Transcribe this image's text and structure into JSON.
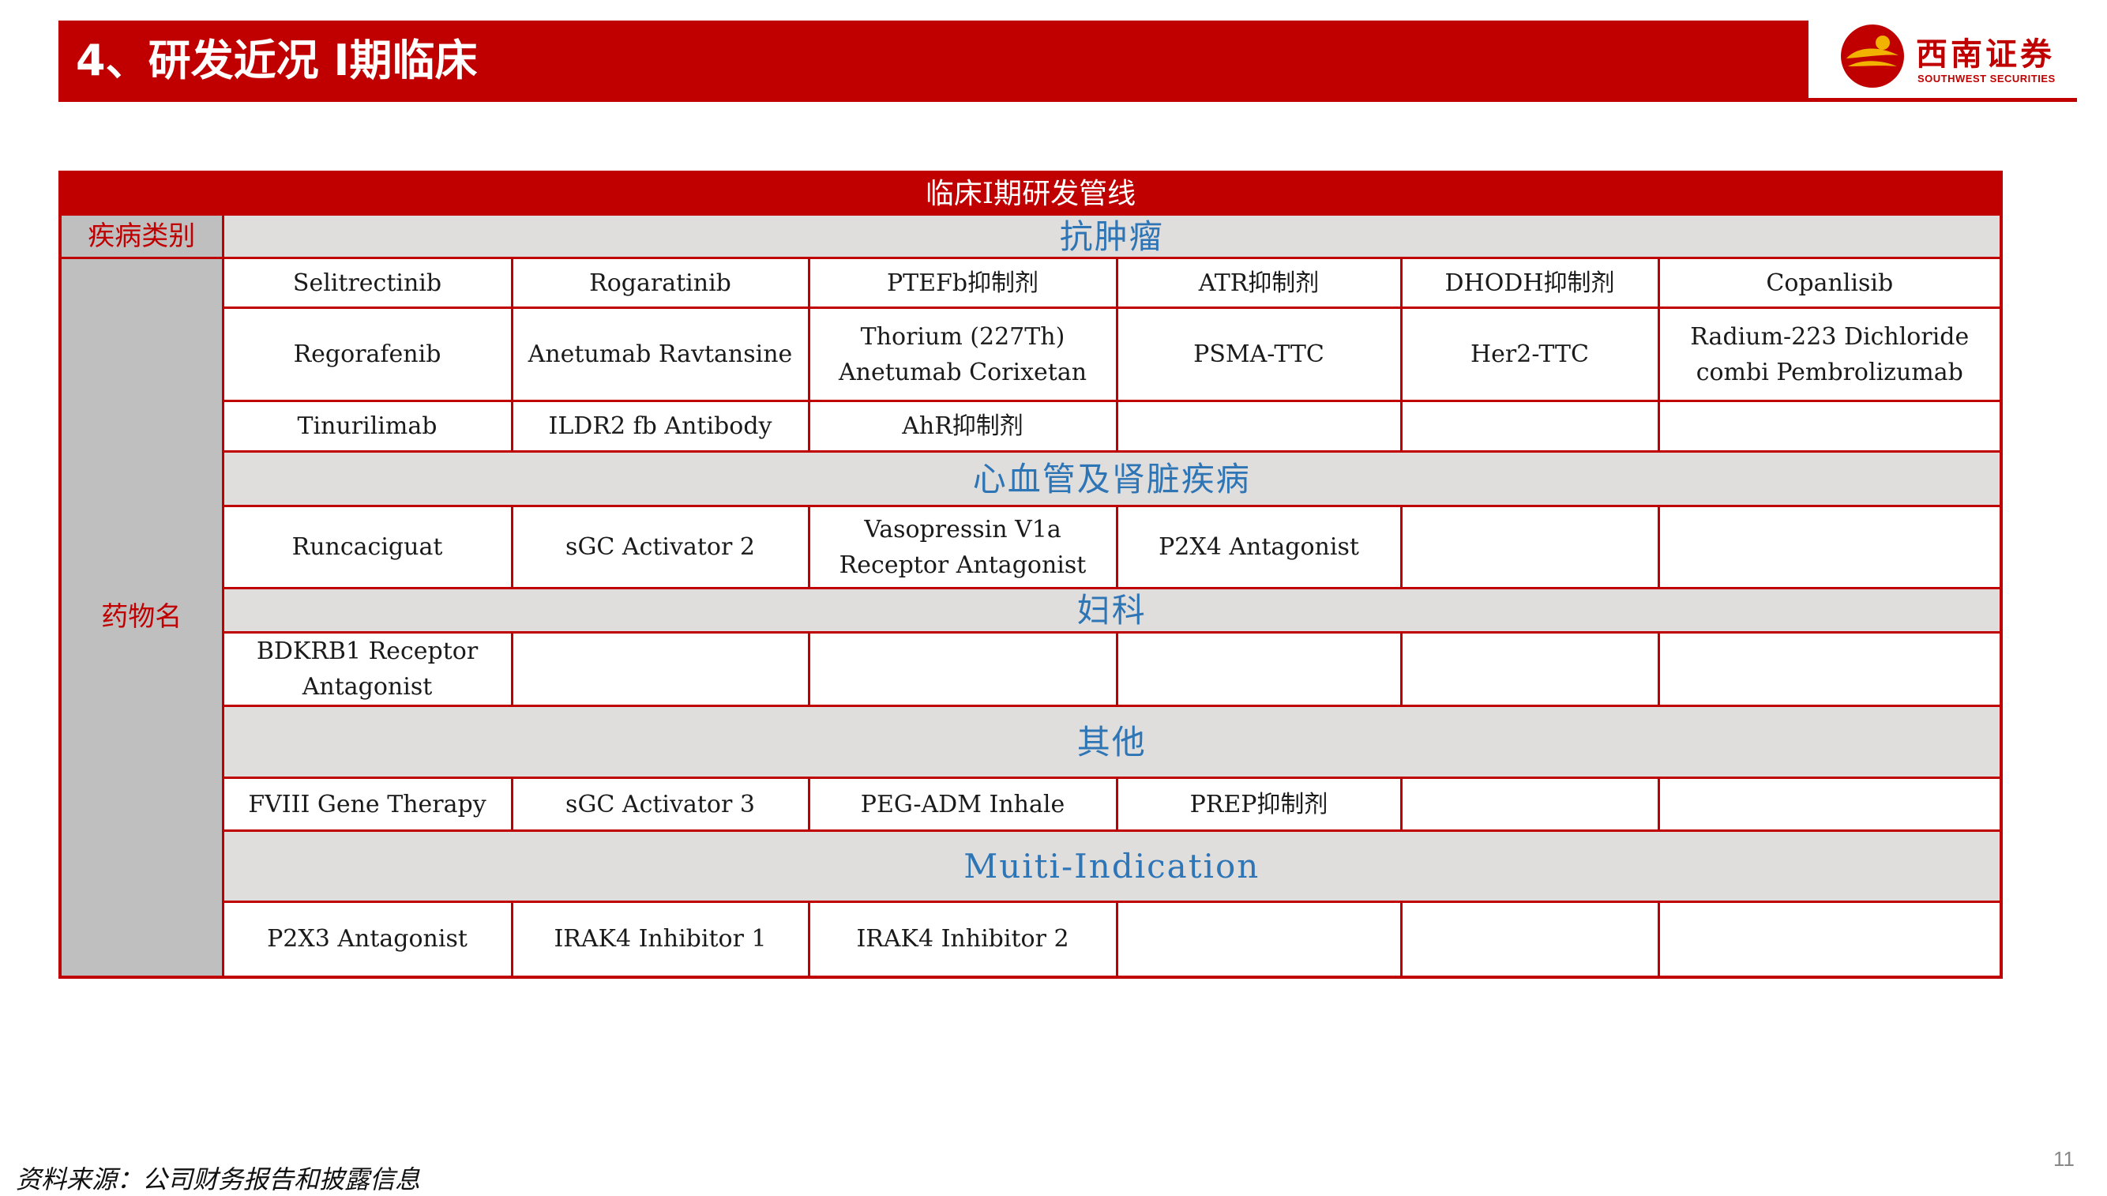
{
  "header": {
    "title": "4、研发近况 I期临床",
    "logo_cn": "西南证券",
    "logo_en": "SOUTHWEST SECURITIES"
  },
  "table": {
    "title": "临床I期研发管线",
    "disease_label": "疾病类别",
    "drug_label": "药物名",
    "sections": [
      {
        "category": "抗肿瘤",
        "rows": [
          [
            "Selitrectinib",
            "Rogaratinib",
            "PTEFb抑制剂",
            "ATR抑制剂",
            "DHODH抑制剂",
            "Copanlisib"
          ],
          [
            "Regorafenib",
            "Anetumab Ravtansine",
            "Thorium (227Th) Anetumab Corixetan",
            "PSMA-TTC",
            "Her2-TTC",
            "Radium-223 Dichloride combi Pembrolizumab"
          ],
          [
            "Tinurilimab",
            "ILDR2 fb Antibody",
            "AhR抑制剂",
            "",
            "",
            ""
          ]
        ]
      },
      {
        "category": "心血管及肾脏疾病",
        "rows": [
          [
            "Runcaciguat",
            "sGC Activator 2",
            "Vasopressin V1a Receptor Antagonist",
            "P2X4 Antagonist",
            "",
            ""
          ]
        ]
      },
      {
        "category": "妇科",
        "rows": [
          [
            "BDKRB1 Receptor Antagonist",
            "",
            "",
            "",
            "",
            ""
          ]
        ]
      },
      {
        "category": "其他",
        "rows": [
          [
            "FVIII Gene Therapy",
            "sGC Activator 3",
            "PEG-ADM Inhale",
            "PREP抑制剂",
            "",
            ""
          ]
        ]
      },
      {
        "category": "Muiti-Indication",
        "rows": [
          [
            "P2X3 Antagonist",
            "IRAK4 Inhibitor 1",
            "IRAK4 Inhibitor 2",
            "",
            "",
            ""
          ]
        ]
      }
    ]
  },
  "footer": {
    "source": "资料来源：公司财务报告和披露信息",
    "page_number": "11"
  },
  "colors": {
    "brand_red": "#c00000",
    "label_gray": "#bfbfbf",
    "category_bg": "#e0dedd",
    "category_text": "#2e75b6"
  }
}
